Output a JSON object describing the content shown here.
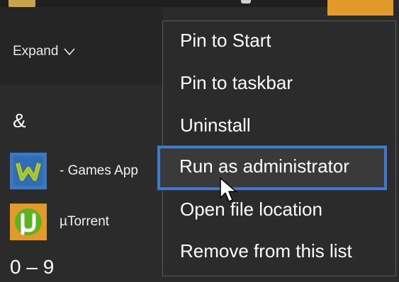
{
  "colors": {
    "background": "#2b2b2b",
    "menu_border": "#5a5a5a",
    "highlight_border": "#3c7bd0",
    "text": "#ffffff",
    "tile_orange": "#e39a2a"
  },
  "sidebar": {
    "expand_label": "Expand"
  },
  "start_list": {
    "header_symbols": "&",
    "header_numbers": "0 – 9",
    "apps": [
      {
        "label": "- Games App",
        "icon": "games-app-icon"
      },
      {
        "label": "µTorrent",
        "icon": "utorrent-icon"
      }
    ]
  },
  "context_menu": {
    "items": [
      {
        "label": "Pin to Start"
      },
      {
        "label": "Pin to taskbar"
      },
      {
        "label": "Uninstall"
      },
      {
        "label": "Run as administrator"
      },
      {
        "label": "Open file location"
      },
      {
        "label": "Remove from this list"
      }
    ],
    "highlighted_index": 3
  }
}
